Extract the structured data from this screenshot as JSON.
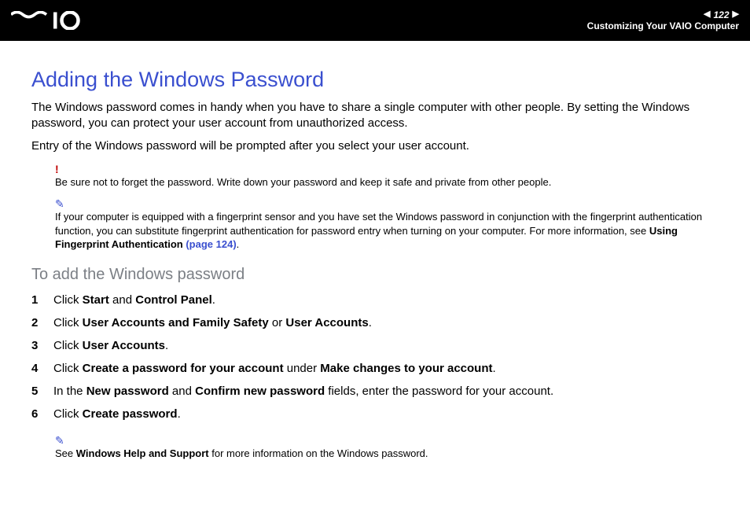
{
  "header": {
    "page_number": "122",
    "breadcrumb": "Customizing Your VAIO Computer"
  },
  "title": "Adding the Windows Password",
  "intro_p1": "The Windows password comes in handy when you have to share a single computer with other people. By setting the Windows password, you can protect your user account from unauthorized access.",
  "intro_p2": "Entry of the Windows password will be prompted after you select your user account.",
  "warn_note": "Be sure not to forget the password. Write down your password and keep it safe and private from other people.",
  "tip1_text_a": "If your computer is equipped with a fingerprint sensor and you have set the Windows password in conjunction with the fingerprint authentication function, you can substitute fingerprint authentication for password entry when turning on your computer. For more information, see ",
  "tip1_bold": "Using Fingerprint Authentication",
  "tip1_link": " (page 124)",
  "tip1_tail": ".",
  "subheading": "To add the Windows password",
  "steps": {
    "s1_a": "Click ",
    "s1_b1": "Start",
    "s1_mid": " and ",
    "s1_b2": "Control Panel",
    "s1_tail": ".",
    "s2_a": "Click ",
    "s2_b1": "User Accounts and Family Safety",
    "s2_mid": " or ",
    "s2_b2": "User Accounts",
    "s2_tail": ".",
    "s3_a": "Click ",
    "s3_b1": "User Accounts",
    "s3_tail": ".",
    "s4_a": "Click ",
    "s4_b1": "Create a password for your account",
    "s4_mid": " under ",
    "s4_b2": "Make changes to your account",
    "s4_tail": ".",
    "s5_a": "In the ",
    "s5_b1": "New password",
    "s5_mid": " and ",
    "s5_b2": "Confirm new password",
    "s5_tail": " fields, enter the password for your account.",
    "s6_a": "Click ",
    "s6_b1": "Create password",
    "s6_tail": "."
  },
  "tip2_a": "See ",
  "tip2_b": "Windows Help and Support",
  "tip2_tail": " for more information on the Windows password."
}
